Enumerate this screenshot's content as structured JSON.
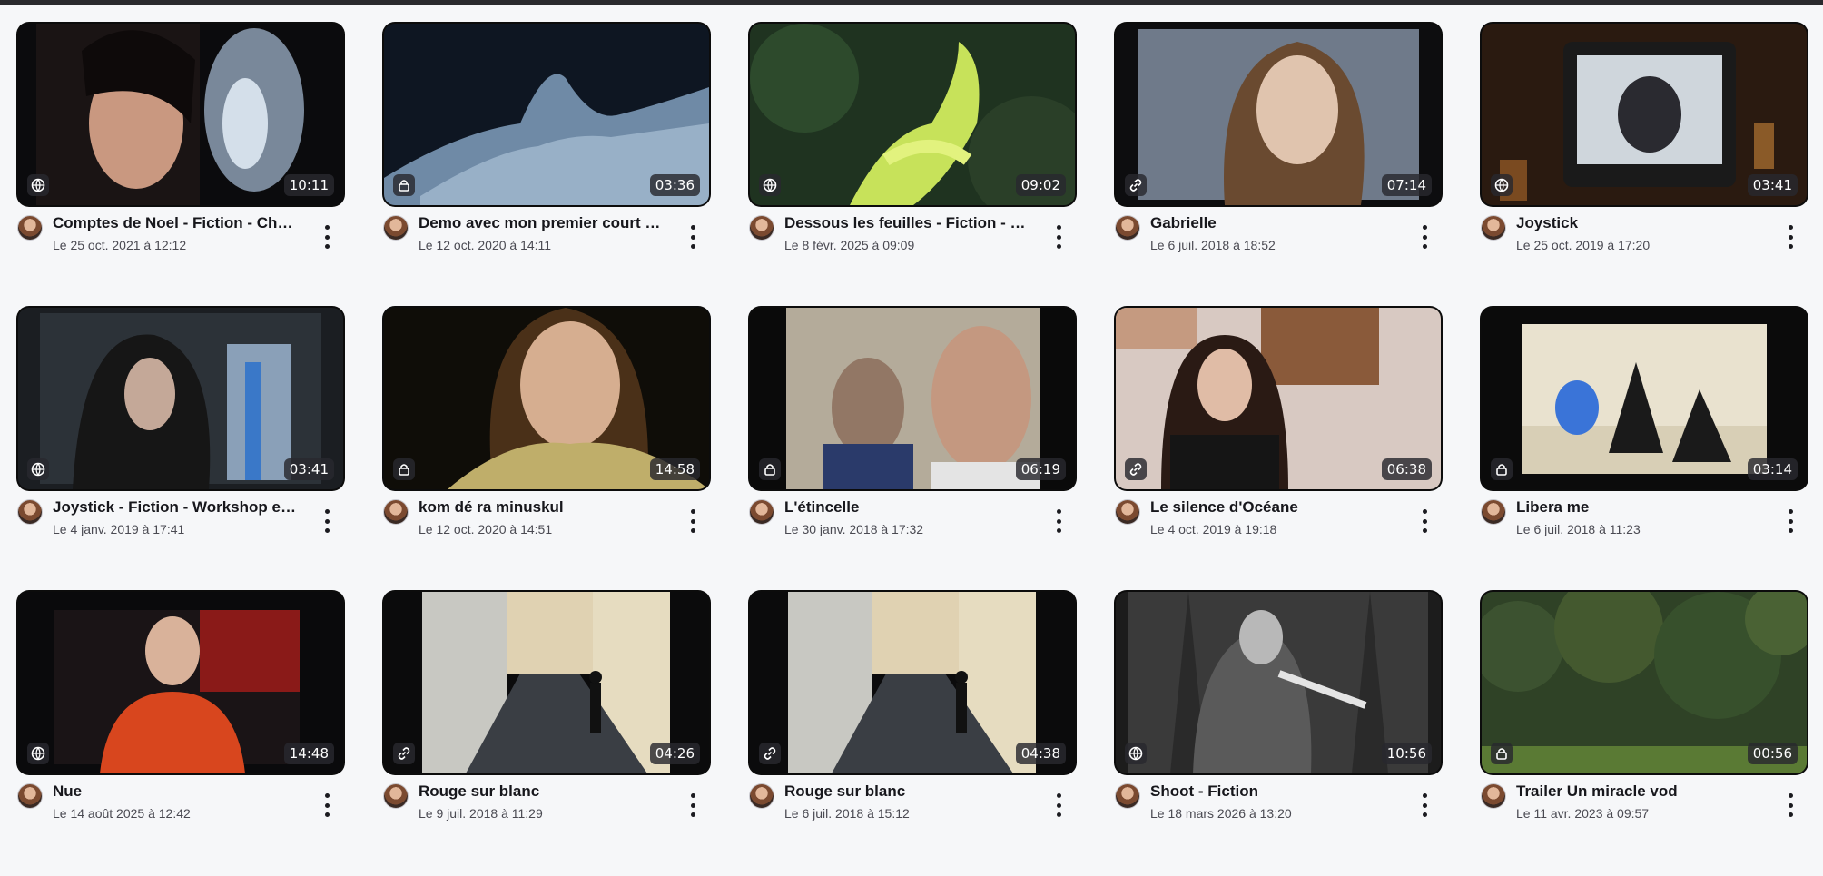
{
  "videos": [
    {
      "title": "Comptes de Noel - Fiction - Cha...",
      "date": "Le 25 oct. 2021 à 12:12",
      "duration": "10:11",
      "visibility": "public",
      "visibility_icon": "globe-icon"
    },
    {
      "title": "Demo avec mon premier court d...",
      "date": "Le 12 oct. 2020 à 14:11",
      "duration": "03:36",
      "visibility": "private",
      "visibility_icon": "lock-icon"
    },
    {
      "title": "Dessous les feuilles - Fiction - Ex...",
      "date": "Le 8 févr. 2025 à 09:09",
      "duration": "09:02",
      "visibility": "public",
      "visibility_icon": "globe-icon"
    },
    {
      "title": "Gabrielle",
      "date": "Le 6 juil. 2018 à 18:52",
      "duration": "07:14",
      "visibility": "unlisted",
      "visibility_icon": "link-icon"
    },
    {
      "title": "Joystick",
      "date": "Le 25 oct. 2019 à 17:20",
      "duration": "03:41",
      "visibility": "public",
      "visibility_icon": "globe-icon"
    },
    {
      "title": "Joystick - Fiction - Workshop enf...",
      "date": "Le 4 janv. 2019 à 17:41",
      "duration": "03:41",
      "visibility": "public",
      "visibility_icon": "globe-icon"
    },
    {
      "title": "kom dé ra minuskul",
      "date": "Le 12 oct. 2020 à 14:51",
      "duration": "14:58",
      "visibility": "private",
      "visibility_icon": "lock-icon"
    },
    {
      "title": "L'étincelle",
      "date": "Le 30 janv. 2018 à 17:32",
      "duration": "06:19",
      "visibility": "private",
      "visibility_icon": "lock-icon"
    },
    {
      "title": "Le silence d'Océane",
      "date": "Le 4 oct. 2019 à 19:18",
      "duration": "06:38",
      "visibility": "unlisted",
      "visibility_icon": "link-icon"
    },
    {
      "title": "Libera me",
      "date": "Le 6 juil. 2018 à 11:23",
      "duration": "03:14",
      "visibility": "private",
      "visibility_icon": "lock-icon"
    },
    {
      "title": "Nue",
      "date": "Le 14 août 2025 à 12:42",
      "duration": "14:48",
      "visibility": "public",
      "visibility_icon": "globe-icon"
    },
    {
      "title": "Rouge sur blanc",
      "date": "Le 9 juil. 2018 à 11:29",
      "duration": "04:26",
      "visibility": "unlisted",
      "visibility_icon": "link-icon"
    },
    {
      "title": "Rouge sur blanc",
      "date": "Le 6 juil. 2018 à 15:12",
      "duration": "04:38",
      "visibility": "unlisted",
      "visibility_icon": "link-icon"
    },
    {
      "title": "Shoot - Fiction",
      "date": "Le 18 mars 2026 à 13:20",
      "duration": "10:56",
      "visibility": "public",
      "visibility_icon": "globe-icon"
    },
    {
      "title": "Trailer Un miracle vod",
      "date": "Le 11 avr. 2023 à 09:57",
      "duration": "00:56",
      "visibility": "private",
      "visibility_icon": "lock-icon"
    }
  ]
}
